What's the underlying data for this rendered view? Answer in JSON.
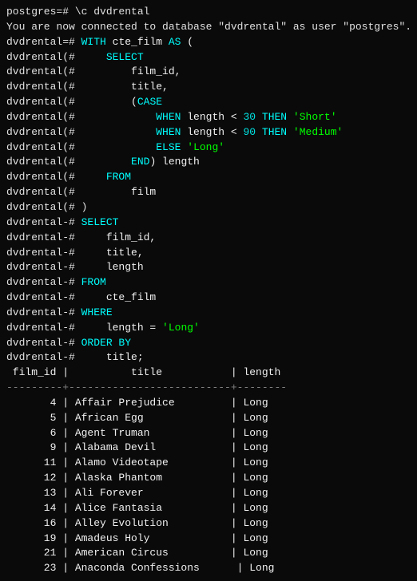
{
  "terminal": {
    "lines": [
      {
        "id": "l1",
        "type": "command",
        "content": "postgres=# \\c dvdrental"
      },
      {
        "id": "l2",
        "type": "info",
        "content": "You are now connected to database \"dvdrental\" as user \"postgres\"."
      },
      {
        "id": "l3",
        "type": "sql",
        "content": "dvdrental=# WITH cte_film AS ("
      },
      {
        "id": "l4",
        "type": "sql",
        "content": "dvdrental(#     SELECT"
      },
      {
        "id": "l5",
        "type": "sql",
        "content": "dvdrental(#         film_id,"
      },
      {
        "id": "l6",
        "type": "sql",
        "content": "dvdrental(#         title,"
      },
      {
        "id": "l7",
        "type": "sql",
        "content": "dvdrental(#         (CASE"
      },
      {
        "id": "l8",
        "type": "sql",
        "content": "dvdrental(#             WHEN length < 30 THEN 'Short'"
      },
      {
        "id": "l9",
        "type": "sql",
        "content": "dvdrental(#             WHEN length < 90 THEN 'Medium'"
      },
      {
        "id": "l10",
        "type": "sql",
        "content": "dvdrental(#             ELSE 'Long'"
      },
      {
        "id": "l11",
        "type": "sql",
        "content": "dvdrental(#         END) length"
      },
      {
        "id": "l12",
        "type": "sql",
        "content": "dvdrental(#     FROM"
      },
      {
        "id": "l13",
        "type": "sql",
        "content": "dvdrental(#         film"
      },
      {
        "id": "l14",
        "type": "sql",
        "content": "dvdrental(# )"
      },
      {
        "id": "l15",
        "type": "sql",
        "content": "dvdrental-# SELECT"
      },
      {
        "id": "l16",
        "type": "sql",
        "content": "dvdrental-#     film_id,"
      },
      {
        "id": "l17",
        "type": "sql",
        "content": "dvdrental-#     title,"
      },
      {
        "id": "l18",
        "type": "sql",
        "content": "dvdrental-#     length"
      },
      {
        "id": "l19",
        "type": "sql",
        "content": "dvdrental-# FROM"
      },
      {
        "id": "l20",
        "type": "sql",
        "content": "dvdrental-#     cte_film"
      },
      {
        "id": "l21",
        "type": "sql",
        "content": "dvdrental-# WHERE"
      },
      {
        "id": "l22",
        "type": "sql",
        "content": "dvdrental-#     length = 'Long'"
      },
      {
        "id": "l23",
        "type": "sql",
        "content": "dvdrental-# ORDER BY"
      },
      {
        "id": "l24",
        "type": "sql",
        "content": "dvdrental-#     title;"
      },
      {
        "id": "l25",
        "type": "table-header",
        "content": " film_id |          title           | length "
      },
      {
        "id": "l26",
        "type": "table-sep",
        "content": "---------+--------------------------+--------"
      },
      {
        "id": "l27",
        "type": "table-row",
        "num": "4",
        "title": "Affair Prejudice",
        "length": "Long"
      },
      {
        "id": "l28",
        "type": "table-row",
        "num": "5",
        "title": "African Egg",
        "length": "Long"
      },
      {
        "id": "l29",
        "type": "table-row",
        "num": "6",
        "title": "Agent Truman",
        "length": "Long"
      },
      {
        "id": "l30",
        "type": "table-row",
        "num": "9",
        "title": "Alabama Devil",
        "length": "Long"
      },
      {
        "id": "l31",
        "type": "table-row",
        "num": "11",
        "title": "Alamo Videotape",
        "length": "Long"
      },
      {
        "id": "l32",
        "type": "table-row",
        "num": "12",
        "title": "Alaska Phantom",
        "length": "Long"
      },
      {
        "id": "l33",
        "type": "table-row",
        "num": "13",
        "title": "Ali Forever",
        "length": "Long"
      },
      {
        "id": "l34",
        "type": "table-row",
        "num": "14",
        "title": "Alice Fantasia",
        "length": "Long"
      },
      {
        "id": "l35",
        "type": "table-row",
        "num": "16",
        "title": "Alley Evolution",
        "length": "Long"
      },
      {
        "id": "l36",
        "type": "table-row",
        "num": "19",
        "title": "Amadeus Holy",
        "length": "Long"
      },
      {
        "id": "l37",
        "type": "table-row",
        "num": "21",
        "title": "American Circus",
        "length": "Long"
      },
      {
        "id": "l38",
        "type": "table-row",
        "num": "23",
        "title": "Anaconda Confessions",
        "length": "Long"
      }
    ]
  }
}
